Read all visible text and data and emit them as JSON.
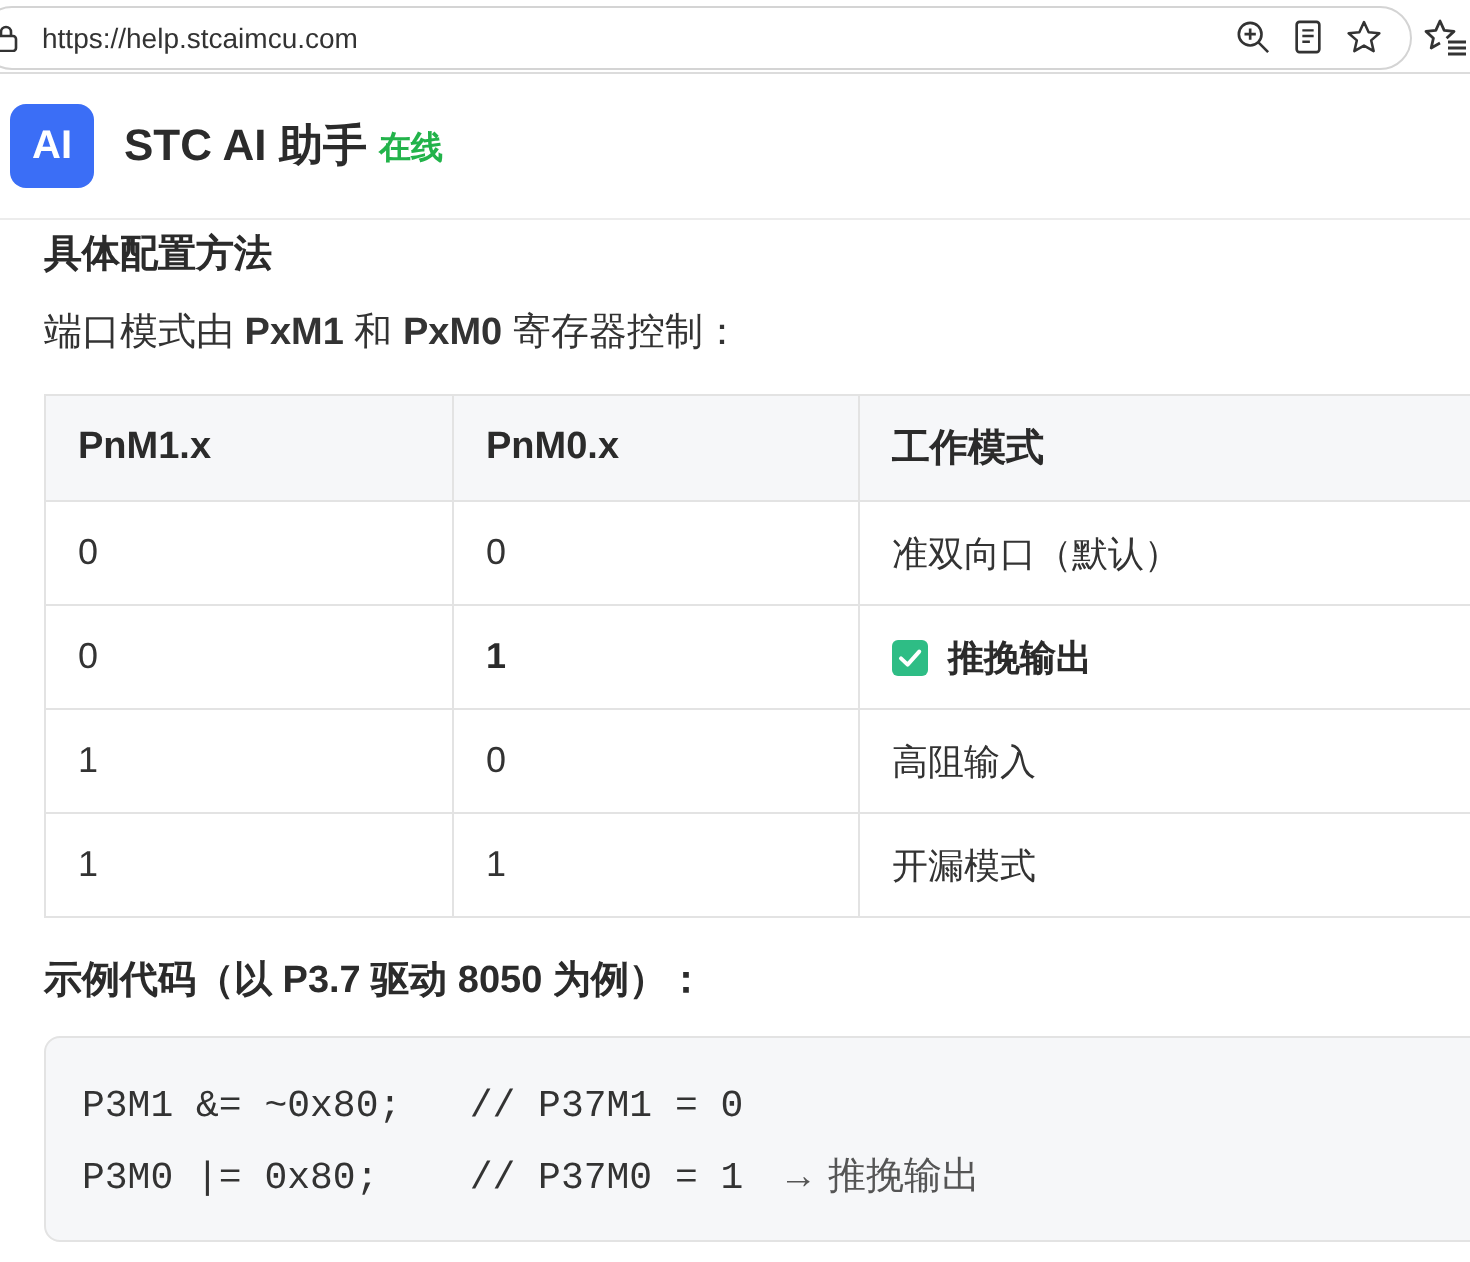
{
  "browser": {
    "url": "https://help.stcaimcu.com"
  },
  "header": {
    "logo": "AI",
    "title": "STC AI 助手",
    "status": "在线"
  },
  "content": {
    "heading": "具体配置方法",
    "intro": "端口模式由 **PxM1** 和 **PxM0** 寄存器控制：",
    "table": {
      "columns": [
        "PnM1.x",
        "PnM0.x",
        "工作模式"
      ],
      "rows": [
        {
          "cells": [
            {
              "text": "0",
              "bold": false,
              "marked": false
            },
            {
              "text": "0",
              "bold": false,
              "marked": false
            },
            {
              "text": "准双向口（默认）",
              "bold": false,
              "marked": false
            }
          ]
        },
        {
          "cells": [
            {
              "text": "0",
              "bold": false,
              "marked": false
            },
            {
              "text": "1",
              "bold": true,
              "marked": false
            },
            {
              "text": "推挽输出",
              "bold": true,
              "marked": true
            }
          ]
        },
        {
          "cells": [
            {
              "text": "1",
              "bold": false,
              "marked": false
            },
            {
              "text": "0",
              "bold": false,
              "marked": false
            },
            {
              "text": "高阻输入",
              "bold": false,
              "marked": false
            }
          ]
        },
        {
          "cells": [
            {
              "text": "1",
              "bold": false,
              "marked": false
            },
            {
              "text": "1",
              "bold": false,
              "marked": false
            },
            {
              "text": "开漏模式",
              "bold": false,
              "marked": false
            }
          ]
        }
      ]
    },
    "code_heading": "示例代码（以 P3.7 驱动 8050 为例）：",
    "code": {
      "lines": [
        {
          "text": "P3M1 &= ~0x80;   // P37M1 = 0"
        },
        {
          "text": "P3M0 |= 0x80;    // P37M0 = 1",
          "note": "→ 推挽输出"
        }
      ]
    }
  }
}
